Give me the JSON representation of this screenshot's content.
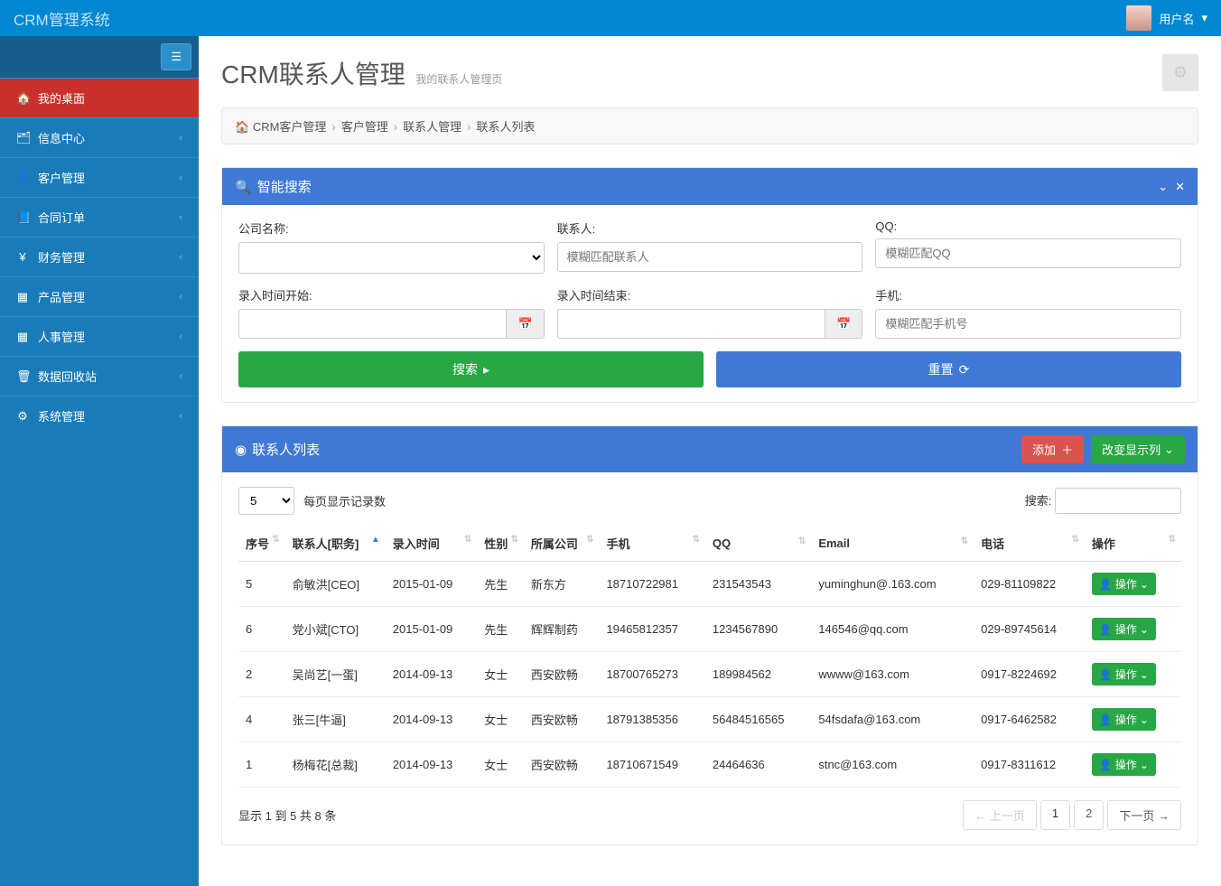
{
  "topbar": {
    "title": "CRM管理系统",
    "username": "用户名"
  },
  "sidebar": {
    "items": [
      {
        "label": "我的桌面",
        "active": true,
        "icon": "🏠",
        "expandable": false
      },
      {
        "label": "信息中心",
        "active": false,
        "icon": "🗂",
        "expandable": true
      },
      {
        "label": "客户管理",
        "active": false,
        "icon": "👤",
        "expandable": true
      },
      {
        "label": "合同订单",
        "active": false,
        "icon": "📘",
        "expandable": true
      },
      {
        "label": "财务管理",
        "active": false,
        "icon": "¥",
        "expandable": true
      },
      {
        "label": "产品管理",
        "active": false,
        "icon": "▦",
        "expandable": true
      },
      {
        "label": "人事管理",
        "active": false,
        "icon": "▦",
        "expandable": true
      },
      {
        "label": "数据回收站",
        "active": false,
        "icon": "🗑",
        "expandable": true
      },
      {
        "label": "系统管理",
        "active": false,
        "icon": "⚙",
        "expandable": true
      }
    ]
  },
  "page": {
    "title": "CRM联系人管理",
    "subtitle": "我的联系人管理页"
  },
  "breadcrumb": [
    "CRM客户管理",
    "客户管理",
    "联系人管理",
    "联系人列表"
  ],
  "search_panel": {
    "title": "智能搜索",
    "fields": {
      "company_label": "公司名称:",
      "contact_label": "联系人:",
      "contact_placeholder": "模糊匹配联系人",
      "qq_label": "QQ:",
      "qq_placeholder": "模糊匹配QQ",
      "start_label": "录入时间开始:",
      "end_label": "录入时间结束:",
      "phone_label": "手机:",
      "phone_placeholder": "模糊匹配手机号"
    },
    "search_btn": "搜索",
    "reset_btn": "重置"
  },
  "list_panel": {
    "title": "联系人列表",
    "add_btn": "添加",
    "columns_btn": "改变显示列",
    "page_size": "5",
    "page_size_label": "每页显示记录数",
    "search_label": "搜索:",
    "headers": [
      "序号",
      "联系人[职务]",
      "录入时间",
      "性别",
      "所属公司",
      "手机",
      "QQ",
      "Email",
      "电话",
      "操作"
    ],
    "rows": [
      {
        "no": "5",
        "contact": "俞敏洪[CEO]",
        "time": "2015-01-09",
        "gender": "先生",
        "company": "新东方",
        "mobile": "18710722981",
        "qq": "231543543",
        "email": "yuminghun@.163.com",
        "tel": "029-81109822"
      },
      {
        "no": "6",
        "contact": "党小斌[CTO]",
        "time": "2015-01-09",
        "gender": "先生",
        "company": "辉辉制药",
        "mobile": "19465812357",
        "qq": "1234567890",
        "email": "146546@qq.com",
        "tel": "029-89745614"
      },
      {
        "no": "2",
        "contact": "吴尚艺[一蛋]",
        "time": "2014-09-13",
        "gender": "女士",
        "company": "西安欧畅",
        "mobile": "18700765273",
        "qq": "189984562",
        "email": "wwww@163.com",
        "tel": "0917-8224692"
      },
      {
        "no": "4",
        "contact": "张三[牛逼]",
        "time": "2014-09-13",
        "gender": "女士",
        "company": "西安欧畅",
        "mobile": "18791385356",
        "qq": "56484516565",
        "email": "54fsdafa@163.com",
        "tel": "0917-6462582"
      },
      {
        "no": "1",
        "contact": "杨梅花[总裁]",
        "time": "2014-09-13",
        "gender": "女士",
        "company": "西安欧畅",
        "mobile": "18710671549",
        "qq": "24464636",
        "email": "stnc@163.com",
        "tel": "0917-8311612"
      }
    ],
    "op_label": "操作",
    "footer_info": "显示 1 到 5 共 8 条",
    "prev": "← 上一页",
    "next": "下一页 →",
    "pages": [
      "1",
      "2"
    ]
  }
}
